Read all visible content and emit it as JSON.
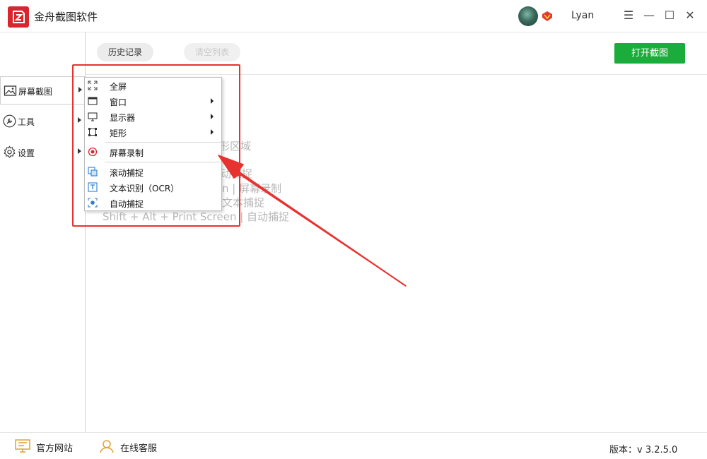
{
  "app": {
    "title": "金舟截图软件",
    "username": "Lyan",
    "accent": "#d8262f"
  },
  "window_controls": {
    "menu": "☰",
    "minimize": "—",
    "maximize": "☐",
    "close": "✕"
  },
  "toolbar": {
    "history_label": "历史记录",
    "clear_label": "清空列表",
    "open_label": "打开截图",
    "open_color": "#1aad3c"
  },
  "sidebar": {
    "items": [
      {
        "label": "屏幕截图",
        "icon": "image-icon"
      },
      {
        "label": "工具",
        "icon": "wrench-icon"
      },
      {
        "label": "设置",
        "icon": "gear-icon"
      }
    ]
  },
  "main": {
    "hints": [
      {
        "text": "形区域"
      },
      {
        "text": "动捕捉"
      },
      {
        "text": "n  |  屏幕录制"
      },
      {
        "text": "文本捕捉"
      },
      {
        "text": "Shift + Alt + Print Screen  |  自动捕捉"
      }
    ]
  },
  "menu": {
    "items": [
      {
        "label": "全屏",
        "icon": "fullscreen-icon",
        "submenu": false
      },
      {
        "label": "窗口",
        "icon": "window-icon",
        "submenu": true
      },
      {
        "label": "显示器",
        "icon": "monitor-icon",
        "submenu": true
      },
      {
        "label": "矩形",
        "icon": "rectangle-icon",
        "submenu": true
      },
      {
        "label": "屏幕录制",
        "icon": "record-icon",
        "submenu": false
      },
      {
        "label": "滚动捕捉",
        "icon": "scroll-capture-icon",
        "submenu": false
      },
      {
        "label": "文本识别（OCR）",
        "icon": "ocr-icon",
        "submenu": false
      },
      {
        "label": "自动捕捉",
        "icon": "auto-capture-icon",
        "submenu": false
      }
    ]
  },
  "annotation": {
    "color": "#e8322f"
  },
  "footer": {
    "website_label": "官方网站",
    "support_label": "在线客服",
    "version": "版本：v 3.2.5.0"
  }
}
